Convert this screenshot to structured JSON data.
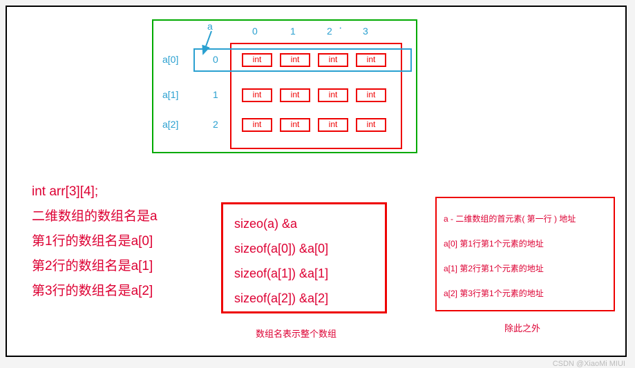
{
  "diagram": {
    "a_label": "a",
    "col_headers": [
      "0",
      "1",
      "2",
      "3"
    ],
    "rows": [
      {
        "left": "a[0]",
        "idx": "0",
        "cells": [
          "int",
          "int",
          "int",
          "int"
        ]
      },
      {
        "left": "a[1]",
        "idx": "1",
        "cells": [
          "int",
          "int",
          "int",
          "int"
        ]
      },
      {
        "left": "a[2]",
        "idx": "2",
        "cells": [
          "int",
          "int",
          "int",
          "int"
        ]
      }
    ],
    "dim_dot": "·"
  },
  "left_block": {
    "l1": "int arr[3][4];",
    "l2": "二维数组的数组名是a",
    "l3": "第1行的数组名是a[0]",
    "l4": "第2行的数组名是a[1]",
    "l5": "第3行的数组名是a[2]"
  },
  "middle_box": {
    "l1": "sizeo(a)    &a",
    "l2": "sizeof(a[0])    &a[0]",
    "l3": "sizeof(a[1])    &a[1]",
    "l4": "sizeof(a[2])    &a[2]"
  },
  "middle_caption": "数组名表示整个数组",
  "right_box": {
    "l1": "a - 二维数组的首元素( 第一行 ) 地址",
    "l2": "a[0] 第1行第1个元素的地址",
    "l3": "a[1] 第2行第1个元素的地址",
    "l4": "a[2] 第3行第1个元素的地址"
  },
  "right_caption": "除此之外",
  "watermark": "CSDN @XiaoMi    MIUI",
  "watermark2": ""
}
